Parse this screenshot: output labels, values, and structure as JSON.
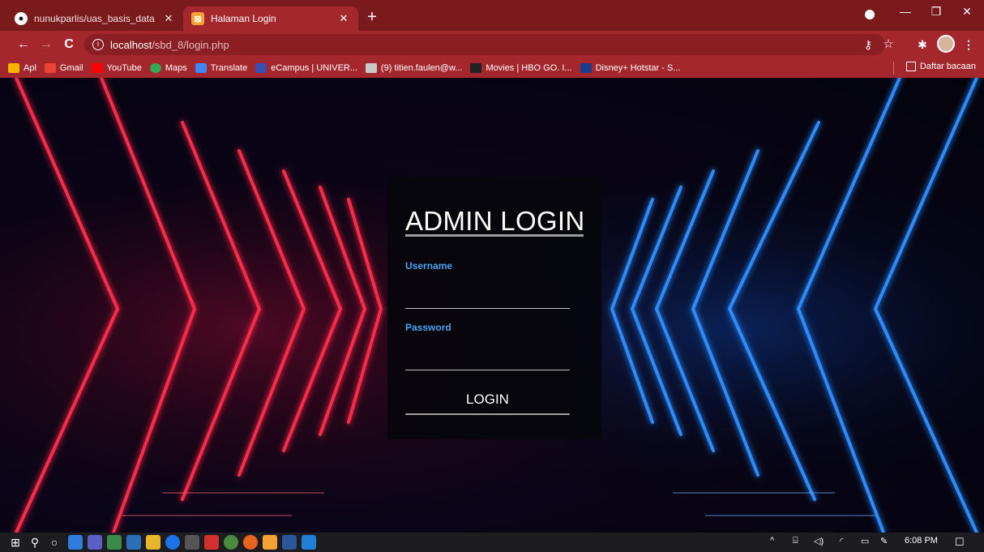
{
  "browser": {
    "tabs": [
      {
        "title": "nunukparlis/uas_basis_data",
        "favicon": "github-icon",
        "active": false
      },
      {
        "title": "Halaman Login",
        "favicon": "phpmyadmin-icon",
        "active": true
      }
    ],
    "url": {
      "host": "localhost",
      "path": "/sbd_8/login.php"
    },
    "bookmarks": [
      {
        "label": "Apl",
        "icon": "apps-grid-icon",
        "color": "#f4b400"
      },
      {
        "label": "Gmail",
        "icon": "gmail-icon",
        "color": "#ea4335"
      },
      {
        "label": "YouTube",
        "icon": "youtube-icon",
        "color": "#ff0000"
      },
      {
        "label": "Maps",
        "icon": "maps-icon",
        "color": "#34a853"
      },
      {
        "label": "Translate",
        "icon": "translate-icon",
        "color": "#4285f4"
      },
      {
        "label": "eCampus | UNIVER...",
        "icon": "ecampus-icon",
        "color": "#3a4fb0"
      },
      {
        "label": "(9) titien.faulen@w...",
        "icon": "mail-icon",
        "color": "#c8c8c8"
      },
      {
        "label": "Movies | HBO GO. I...",
        "icon": "hbo-icon",
        "color": "#222222"
      },
      {
        "label": "Disney+ Hotstar - S...",
        "icon": "hotstar-icon",
        "color": "#1b3a8c"
      }
    ],
    "reading_list": "Daftar bacaan"
  },
  "login": {
    "title": "ADMIN LOGIN",
    "username_label": "Username",
    "username_value": "",
    "password_label": "Password",
    "password_value": "",
    "button_label": "LOGIN"
  },
  "taskbar": {
    "clock": "6:08 PM"
  },
  "colors": {
    "tab_bar": "#7a1a1d",
    "toolbar": "#a3272c",
    "label_accent": "#4aa3f0",
    "neon_red": "#ff2a4a",
    "neon_blue": "#2a8cff"
  }
}
